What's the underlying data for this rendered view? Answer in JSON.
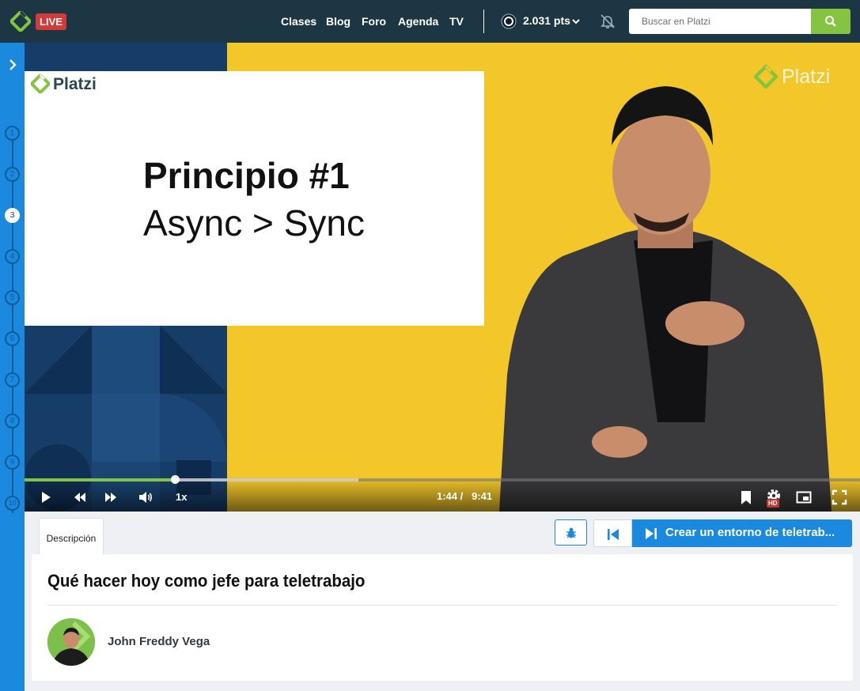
{
  "header": {
    "live_badge": "LIVE",
    "nav": [
      "Clases",
      "Blog",
      "Foro",
      "Agenda",
      "TV"
    ],
    "points": "2.031 pts",
    "search_placeholder": "Buscar en Platzi"
  },
  "rail": {
    "steps": [
      "1",
      "2",
      "3",
      "4",
      "5",
      "6",
      "7",
      "8",
      "9",
      "10"
    ],
    "active_step": 3
  },
  "video": {
    "slide_brand": "Platzi",
    "slide_title": "Principio #1",
    "slide_subtitle": "Async > Sync",
    "watermark": "Platzi",
    "progress_fraction": 0.18,
    "buffered_fraction": 0.4,
    "speed": "1x",
    "current_time": "1:44",
    "time_separator": "/",
    "duration": "9:41",
    "hd_badge": "HD"
  },
  "tabs": {
    "description": "Descripción"
  },
  "next_class": {
    "label": "Crear un entorno de teletrab..."
  },
  "class_info": {
    "title": "Qué hacer hoy como jefe para teletrabajo",
    "teacher": "John Freddy Vega"
  },
  "colors": {
    "nav_bg": "#1c3643",
    "brand_green": "#85c440",
    "rail_blue": "#1a89de",
    "live_red": "#d33a3a",
    "video_yellow": "#f3c72a",
    "slide_blue": "#163d68"
  },
  "icons": {
    "logo": "platzi-logo-icon",
    "search": "search-icon",
    "bell": "bell-off-icon",
    "play": "play-icon",
    "rewind": "rewind-icon",
    "forward": "forward-icon",
    "volume": "volume-icon",
    "bookmark": "bookmark-icon",
    "settings": "gear-icon",
    "pip": "picture-in-picture-icon",
    "fullscreen": "fullscreen-icon",
    "bug": "bug-icon",
    "previous": "previous-class-icon",
    "next": "next-class-icon"
  }
}
